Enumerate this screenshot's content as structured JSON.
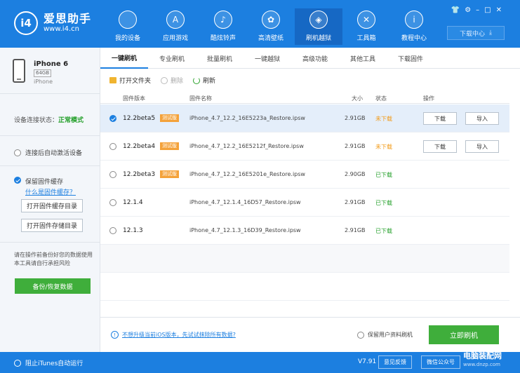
{
  "app": {
    "title": "爱思助手",
    "url": "www.i4.cn",
    "logo": "i4"
  },
  "nav": [
    {
      "label": "我的设备",
      "icon": "apple-icon",
      "glyph": ""
    },
    {
      "label": "应用游戏",
      "icon": "app-store-icon",
      "glyph": "A"
    },
    {
      "label": "酷炫铃声",
      "icon": "bell-icon",
      "glyph": "♪"
    },
    {
      "label": "高清壁纸",
      "icon": "flower-icon",
      "glyph": "✿"
    },
    {
      "label": "刷机越狱",
      "icon": "dropbox-icon",
      "glyph": "◈"
    },
    {
      "label": "工具箱",
      "icon": "tools-icon",
      "glyph": "✕"
    },
    {
      "label": "教程中心",
      "icon": "info-icon",
      "glyph": "i"
    }
  ],
  "window_controls": [
    "👕",
    "⚙",
    "–",
    "□",
    "✕"
  ],
  "download_center": {
    "label": "下载中心",
    "icon": "⤓"
  },
  "device": {
    "name": "iPhone 6",
    "capacity": "64GB",
    "type": "iPhone"
  },
  "connection": {
    "label": "设备连接状态：",
    "state": "正常模式"
  },
  "sidebar": {
    "activate_label": "连接后自动激活设备",
    "keep_cache_label": "保留固件缓存",
    "what_is_cache": "什么是固件缓存？",
    "open_cache_dir": "打开固件缓存目录",
    "open_store_dir": "打开固件存储目录",
    "tip": "请在操作前备份好您的数据使用本工具请自行承担风险",
    "backup_button": "备份/恢复数据"
  },
  "tabs": [
    "一键刷机",
    "专业刷机",
    "批量刷机",
    "一键越狱",
    "高级功能",
    "其他工具",
    "下载固件"
  ],
  "toolbar": {
    "open_folder": "打开文件夹",
    "delete": "删除",
    "refresh": "刷新"
  },
  "table": {
    "headers": {
      "version": "固件版本",
      "name": "固件名称",
      "size": "大小",
      "status": "状态",
      "action": "操作"
    },
    "rows": [
      {
        "version": "12.2beta5",
        "badge": "测试版",
        "name": "iPhone_4.7_12.2_16E5223a_Restore.ipsw",
        "size": "2.91GB",
        "status": "未下载",
        "download": "下载",
        "import": "导入"
      },
      {
        "version": "12.2beta4",
        "badge": "测试版",
        "name": "iPhone_4.7_12.2_16E5212f_Restore.ipsw",
        "size": "2.91GB",
        "status": "未下载",
        "download": "下载",
        "import": "导入"
      },
      {
        "version": "12.2beta3",
        "badge": "测试版",
        "name": "iPhone_4.7_12.2_16E5201e_Restore.ipsw",
        "size": "2.90GB",
        "status": "已下载"
      },
      {
        "version": "12.1.4",
        "name": "iPhone_4.7_12.1.4_16D57_Restore.ipsw",
        "size": "2.91GB",
        "status": "已下载"
      },
      {
        "version": "12.1.3",
        "name": "iPhone_4.7_12.1.3_16D39_Restore.ipsw",
        "size": "2.91GB",
        "status": "已下载"
      }
    ]
  },
  "bottom": {
    "warn_icon": "!",
    "warn_link": "不想升级当前iOS版本，先试试抹除所有数据?",
    "keep_user_data": "保留用户资料刷机",
    "flash_button": "立即刷机"
  },
  "statusbar": {
    "itunes": "阻止iTunes自动运行",
    "version": "V7.91",
    "feedback": "意见反馈",
    "wechat": "微信公众号",
    "watermark": "电脑装配网",
    "watermark_sub": "www.dnzp.com"
  },
  "colors": {
    "primary": "#1c7fe0",
    "green": "#3fae3b",
    "orange": "#f29a16",
    "badge": "#f4a23a"
  }
}
